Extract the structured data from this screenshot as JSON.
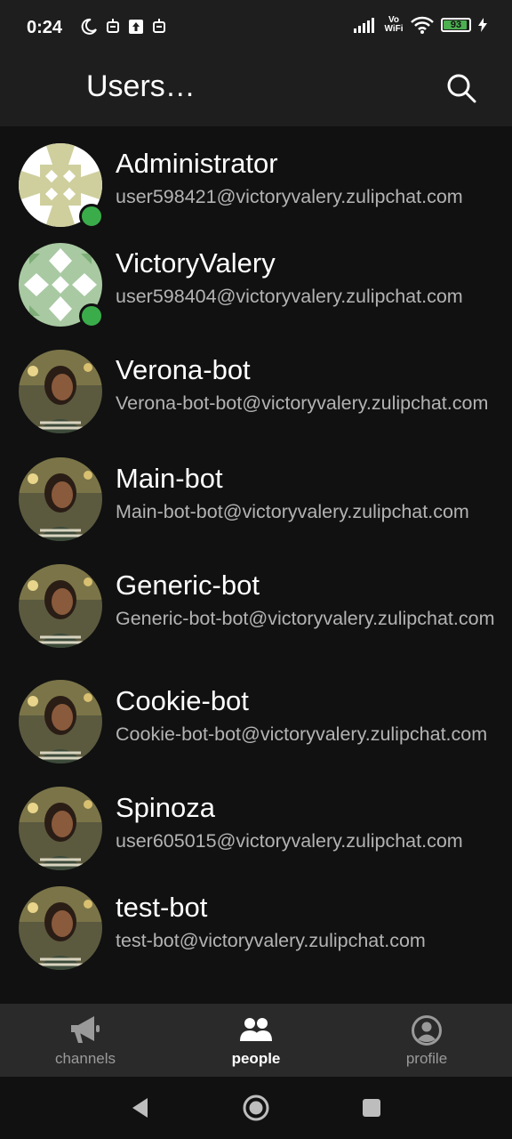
{
  "status_bar": {
    "time": "0:24",
    "network_label": "Vo WiFi",
    "battery": "93"
  },
  "app_bar": {
    "title": "Users…",
    "search_icon": "search-icon"
  },
  "users": [
    {
      "name": "Administrator",
      "email": "user598421@victoryvalery.zulipchat.com",
      "avatar": "pattern-olive",
      "online": true
    },
    {
      "name": "VictoryValery",
      "email": "user598404@victoryvalery.zulipchat.com",
      "avatar": "pattern-green",
      "online": true
    },
    {
      "name": "Verona-bot",
      "email": "Verona-bot-bot@victoryvalery.zulipchat.com",
      "avatar": "photo",
      "online": false
    },
    {
      "name": "Main-bot",
      "email": "Main-bot-bot@victoryvalery.zulipchat.com",
      "avatar": "photo",
      "online": false
    },
    {
      "name": "Generic-bot",
      "email": "Generic-bot-bot@victoryvalery.zulipchat.com",
      "avatar": "photo",
      "online": false
    },
    {
      "name": "Cookie-bot",
      "email": "Cookie-bot-bot@victoryvalery.zulipchat.com",
      "avatar": "photo",
      "online": false
    },
    {
      "name": "Spinoza",
      "email": "user605015@victoryvalery.zulipchat.com",
      "avatar": "photo",
      "online": false
    },
    {
      "name": "test-bot",
      "email": "test-bot@victoryvalery.zulipchat.com",
      "avatar": "photo",
      "online": false
    }
  ],
  "bottom_nav": {
    "items": [
      {
        "label": "channels",
        "icon": "megaphone-icon",
        "active": false
      },
      {
        "label": "people",
        "icon": "people-icon",
        "active": true
      },
      {
        "label": "profile",
        "icon": "profile-icon",
        "active": false
      }
    ]
  },
  "system_nav": {
    "back_icon": "back-icon",
    "home_icon": "home-icon",
    "recents_icon": "recents-icon"
  },
  "colors": {
    "background": "#111111",
    "app_bar": "#1e1e1e",
    "online": "#3aad4a",
    "secondary_text": "#b3b3b3"
  }
}
